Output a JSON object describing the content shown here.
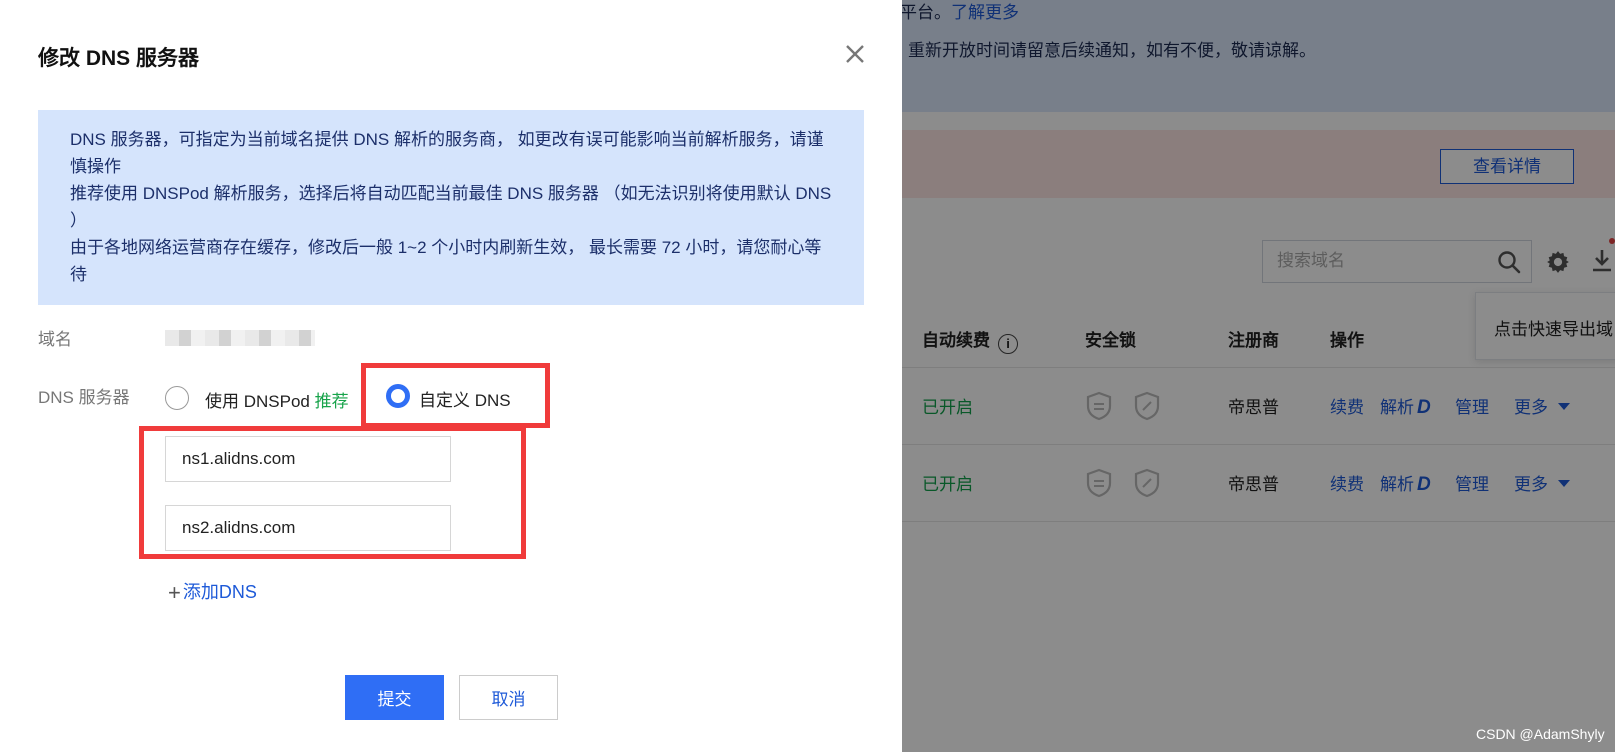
{
  "background": {
    "notice_line1_text": "平台。",
    "notice_line1_link": "了解更多",
    "notice_line2": "重新开放时间请留意后续通知，如有不便，敬请谅解。",
    "detail_button": "查看详情",
    "search_placeholder": "搜索域名",
    "tooltip_text": "点击快速导出域",
    "table_headers": {
      "auto_renew": "自动续费",
      "security_lock": "安全锁",
      "registrar": "注册商",
      "actions": "操作"
    },
    "rows": [
      {
        "auto_renew": "已开启",
        "registrar": "帝思普",
        "renew": "续费",
        "resolve": "解析",
        "manage": "管理",
        "more": "更多"
      },
      {
        "auto_renew": "已开启",
        "registrar": "帝思普",
        "renew": "续费",
        "resolve": "解析",
        "manage": "管理",
        "more": "更多"
      }
    ],
    "watermark": "CSDN @AdamShyly"
  },
  "modal": {
    "title": "修改 DNS 服务器",
    "alert_lines": [
      "DNS 服务器，可指定为当前域名提供 DNS 解析的服务商， 如更改有误可能影响当前解析服务，请谨慎操作",
      "推荐使用 DNSPod 解析服务，选择后将自动匹配当前最佳 DNS 服务器 （如无法识别将使用默认 DNS ）",
      "由于各地网络运营商存在缓存，修改后一般 1~2 个小时内刷新生效， 最长需要 72 小时，请您耐心等待"
    ],
    "domain_label": "域名",
    "dns_label": "DNS 服务器",
    "option_dnspod": "使用 DNSPod",
    "option_dnspod_badge": "推荐",
    "option_custom": "自定义 DNS",
    "selected_option": "自定义 DNS",
    "dns_values": [
      "ns1.alidns.com",
      "ns2.alidns.com"
    ],
    "add_dns": "添加DNS",
    "submit": "提交",
    "cancel": "取消"
  },
  "colors": {
    "primary": "#2f6ef5",
    "link": "#1e5ad8",
    "highlight": "#f03b3b",
    "success": "#12a14b",
    "alert_bg": "#d5e4fc"
  }
}
